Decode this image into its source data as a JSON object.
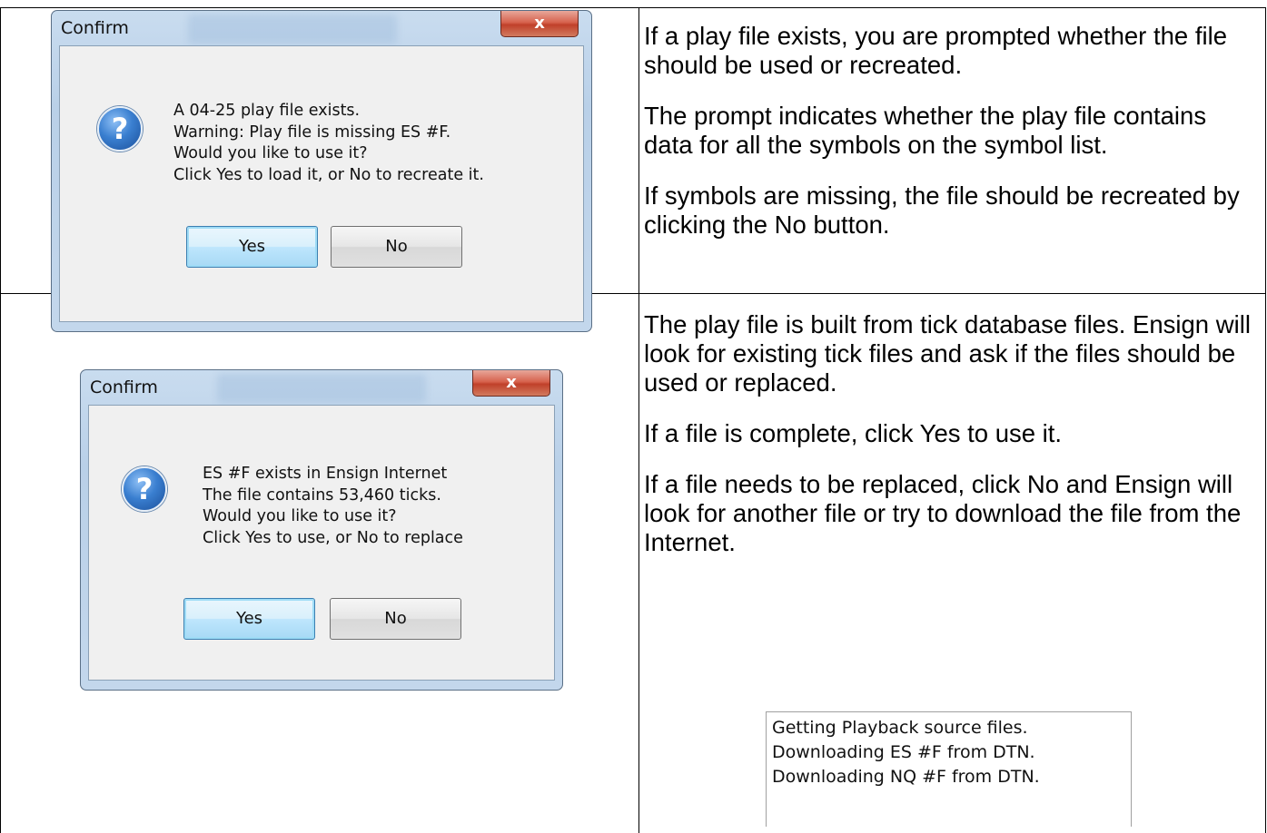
{
  "dialog_top": {
    "title": "Confirm",
    "close_glyph": "x",
    "icon": "question-icon",
    "message_lines": [
      "A 04-25 play file exists.",
      "Warning:  Play file is missing ES #F.",
      "Would you like to use it?",
      "Click Yes to load it, or No to recreate it."
    ],
    "yes_label": "Yes",
    "no_label": "No"
  },
  "desc_top": {
    "paragraphs": [
      "If a play file exists, you are prompted whether the file should be used or recreated.",
      "The prompt indicates whether the play file contains data for all the symbols on the symbol list.",
      "If symbols are missing, the file should be recreated by clicking the No button."
    ]
  },
  "dialog_bottom": {
    "title": "Confirm",
    "close_glyph": "x",
    "icon": "question-icon",
    "message_lines": [
      "ES #F exists in Ensign Internet",
      "The file contains 53,460 ticks.",
      "Would you like to use it?",
      "Click Yes to use, or No to replace"
    ],
    "yes_label": "Yes",
    "no_label": "No"
  },
  "desc_bottom": {
    "paragraphs": [
      "The play file is built from tick database files. Ensign will look for existing tick files and ask if the files should be used or replaced.",
      "If a file is complete, click Yes to use it.",
      "If a file needs to be replaced, click No and Ensign will look for another file or try to download the file from the Internet."
    ]
  },
  "status_log": {
    "lines": [
      "Getting Playback source files.",
      "Downloading ES #F from DTN.",
      "Downloading NQ #F from DTN."
    ]
  },
  "colors": {
    "dialog_frame": "#b9d0e8",
    "close_button": "#c0402a",
    "default_button": "#bee6fd",
    "question_icon": "#3a7fd0"
  }
}
